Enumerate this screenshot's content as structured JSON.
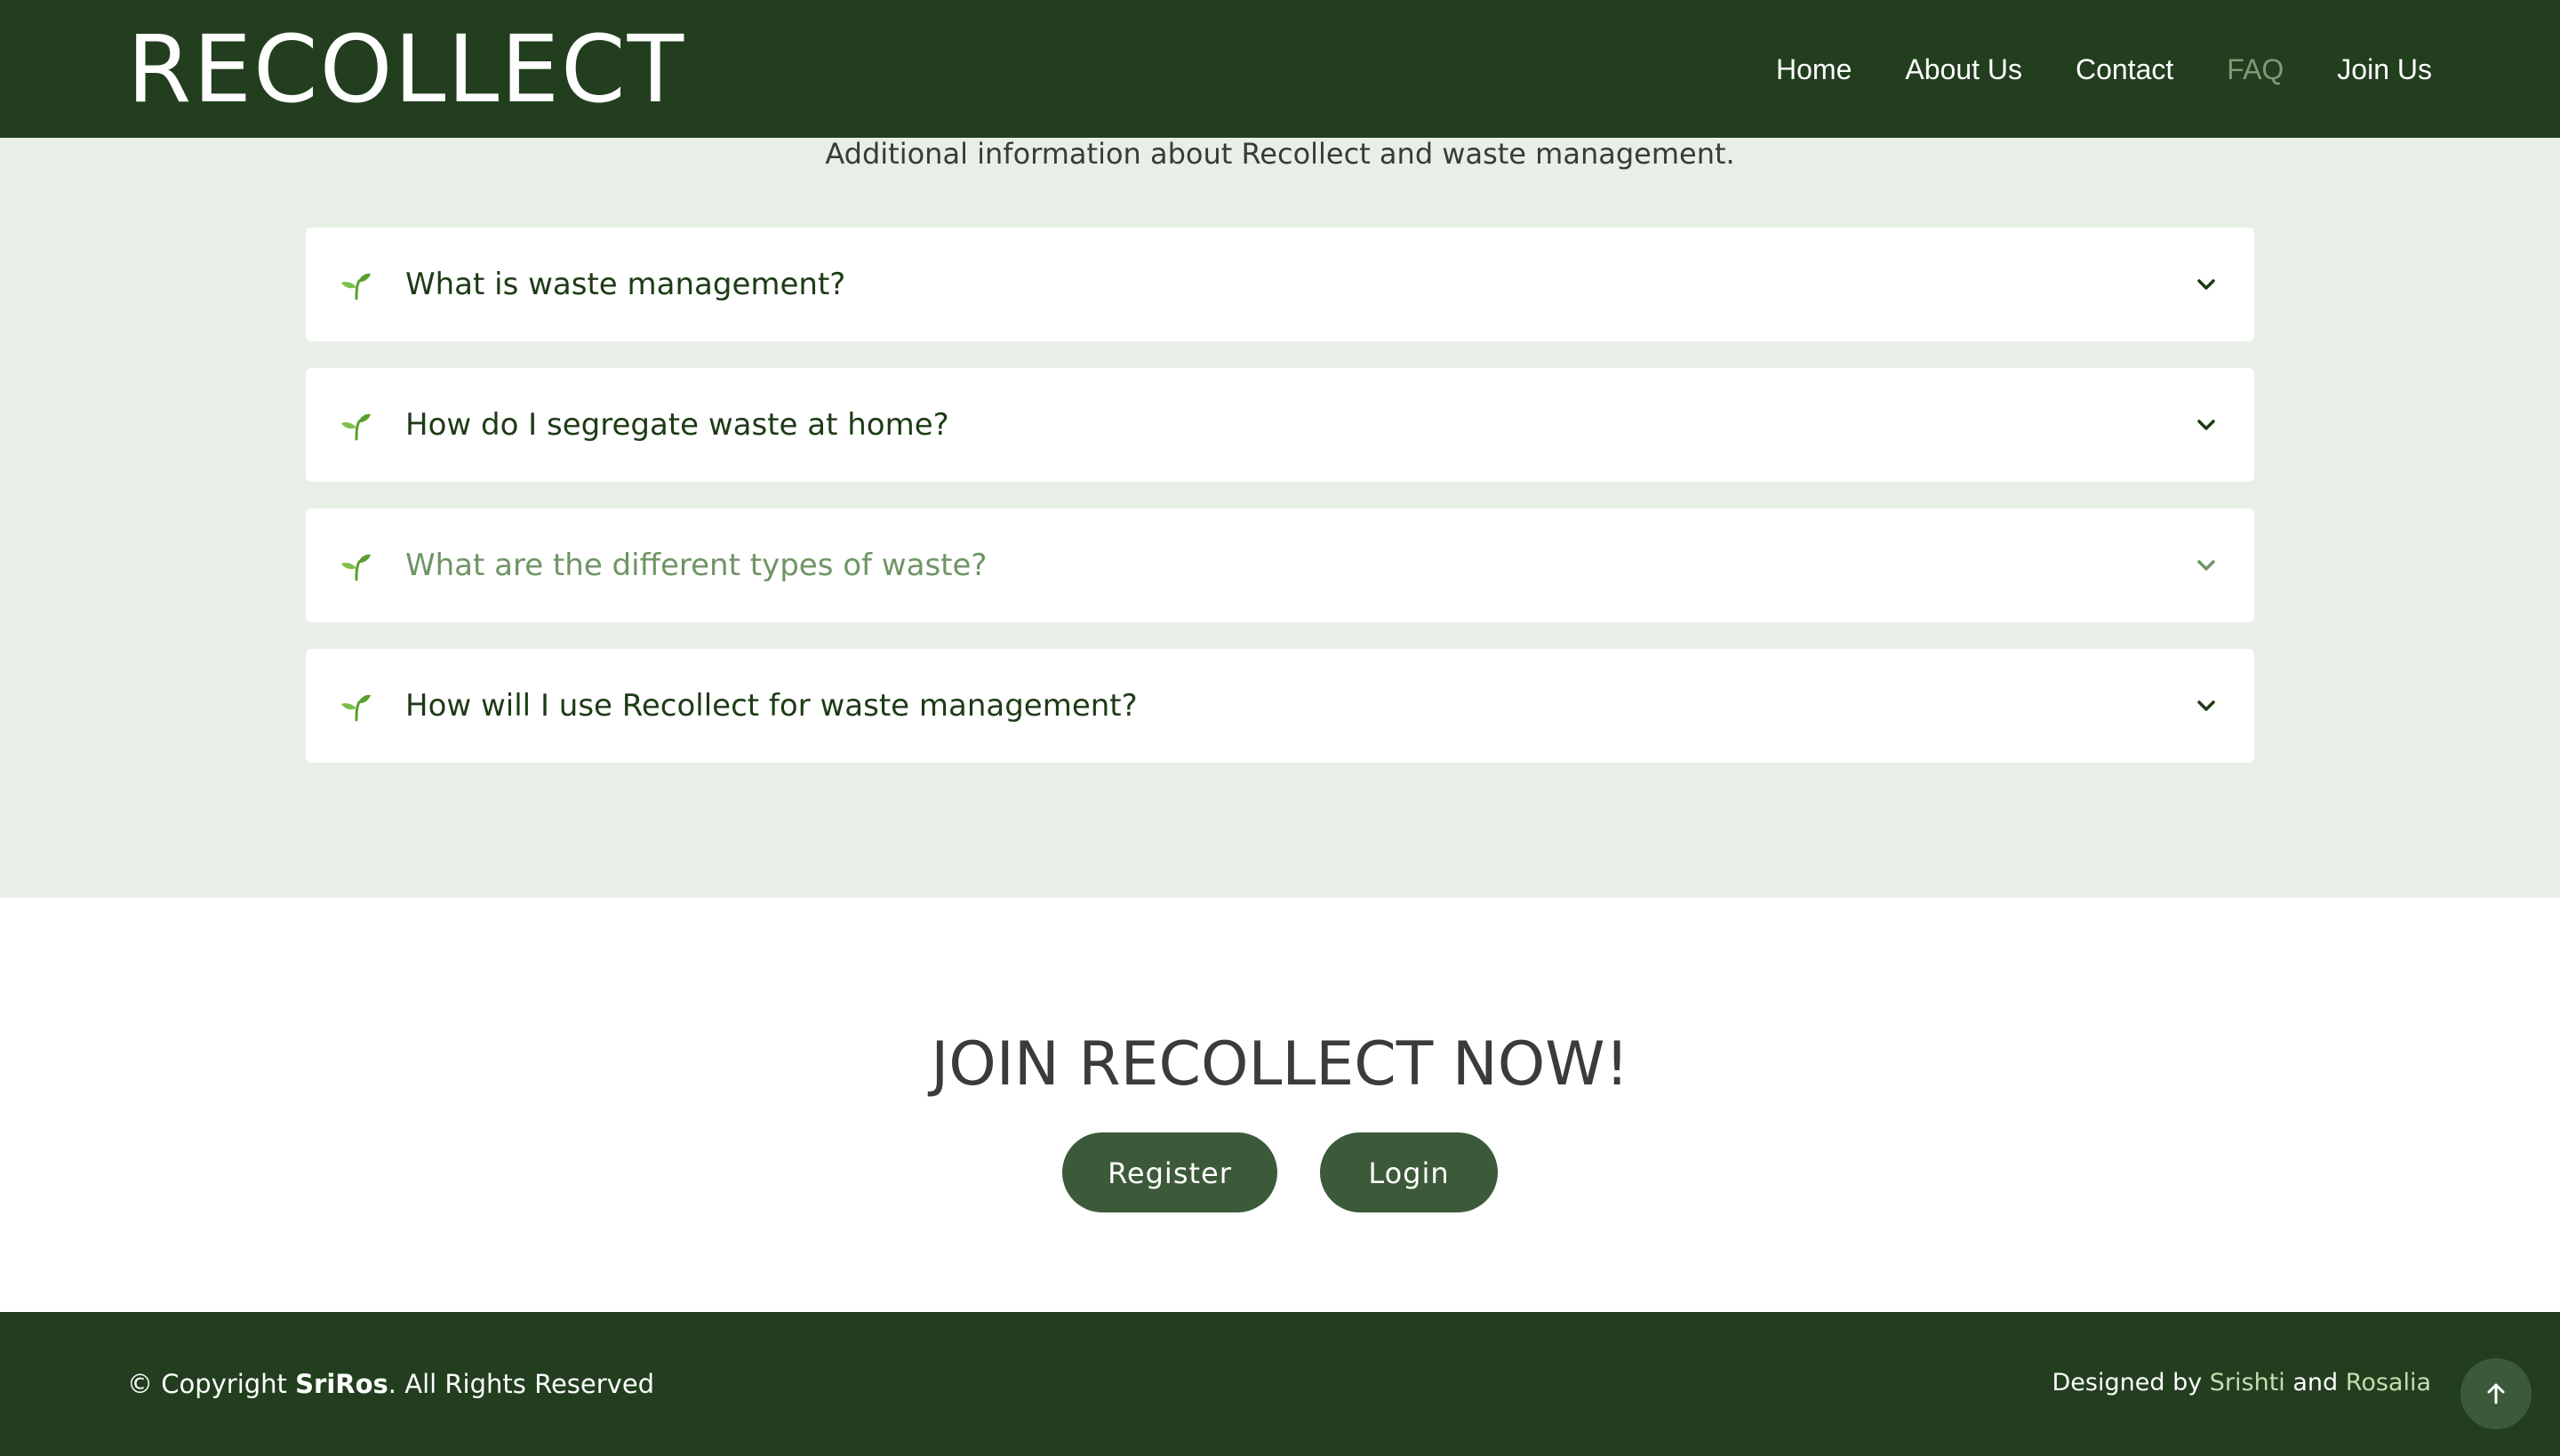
{
  "header": {
    "logo": "RECOLLECT",
    "nav": [
      {
        "label": "Home",
        "active": false
      },
      {
        "label": "About Us",
        "active": false
      },
      {
        "label": "Contact",
        "active": false
      },
      {
        "label": "FAQ",
        "active": true
      },
      {
        "label": "Join Us",
        "active": false
      }
    ]
  },
  "faq": {
    "subtitle": "Additional information about Recollect and waste management.",
    "items": [
      {
        "question": "What is waste management?"
      },
      {
        "question": "How do I segregate waste at home?"
      },
      {
        "question": "What are the different types of waste?"
      },
      {
        "question": "How will I use Recollect for waste management?"
      }
    ]
  },
  "join": {
    "title": "JOIN RECOLLECT NOW!",
    "register_label": "Register",
    "login_label": "Login"
  },
  "footer": {
    "copyright_prefix": "© Copyright ",
    "copyright_brand": "SriRos",
    "copyright_suffix": ". All Rights Reserved",
    "designed_prefix": "Designed by ",
    "designer_1": "Srishti",
    "designed_and": " and ",
    "designer_2": "Rosalia"
  },
  "icons": {
    "faq_item": "seedling-icon",
    "toggle": "chevron-down-icon",
    "back_to_top": "arrow-up-icon"
  },
  "colors": {
    "brand_dark": "#223e1f",
    "button": "#3c5a39",
    "section_bg": "#e8efe7",
    "leaf": "#5aa02c",
    "muted_question": "#6f9465"
  }
}
